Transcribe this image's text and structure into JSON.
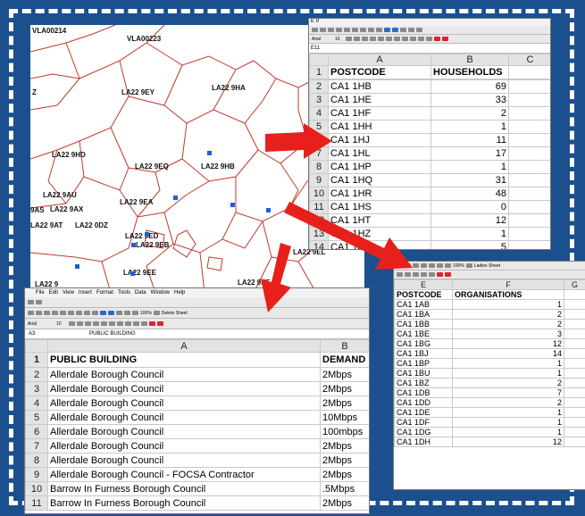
{
  "map": {
    "labels": [
      "VLA00214",
      "VLA00223",
      "LA22 9EY",
      "LA22 9HA",
      "LA22 9HD",
      "LA22 9EQ",
      "LA22 9HB",
      "LA22 9AU",
      "9AS",
      "LA22 9AX",
      "LA22 9EA",
      "LA22 9AT",
      "LA22 0DZ",
      "LA22 9ED",
      "LA22 9EB",
      "LA22 9EE",
      "LA22 9EL",
      "LA22 9EF",
      "LA22 9",
      "Z"
    ]
  },
  "sheet1": {
    "menu": "E 9",
    "font_name": "Arial",
    "font_size": "10",
    "cell_ref": "E11",
    "col_headers": [
      "A",
      "B",
      "C"
    ],
    "header": [
      "POSTCODE",
      "HOUSEHOLDS"
    ],
    "rows": [
      {
        "n": "2",
        "a": "CA1 1HB",
        "b": "69"
      },
      {
        "n": "3",
        "a": "CA1 1HE",
        "b": "33"
      },
      {
        "n": "4",
        "a": "CA1 1HF",
        "b": "2"
      },
      {
        "n": "5",
        "a": "CA1 1HH",
        "b": "1"
      },
      {
        "n": "6",
        "a": "CA1 1HJ",
        "b": "11"
      },
      {
        "n": "7",
        "a": "CA1 1HL",
        "b": "17"
      },
      {
        "n": "8",
        "a": "CA1 1HP",
        "b": "1"
      },
      {
        "n": "9",
        "a": "CA1 1HQ",
        "b": "31"
      },
      {
        "n": "10",
        "a": "CA1 1HR",
        "b": "48"
      },
      {
        "n": "11",
        "a": "CA1 1HS",
        "b": "0"
      },
      {
        "n": "12",
        "a": "CA1 1HT",
        "b": "12"
      },
      {
        "n": "13",
        "a": "CA1 1HZ",
        "b": "1"
      },
      {
        "n": "14",
        "a": "CA1 1JA",
        "b": "5"
      }
    ]
  },
  "sheet2": {
    "toolbar_text": "Ladies Sheet",
    "zoom": "100%",
    "col_headers": [
      "E",
      "F",
      "G"
    ],
    "header": [
      "POSTCODE",
      "ORGANISATIONS"
    ],
    "rows": [
      {
        "a": "CA1 1AB",
        "b": "1"
      },
      {
        "a": "CA1 1BA",
        "b": "2"
      },
      {
        "a": "CA1 1BB",
        "b": "2"
      },
      {
        "a": "CA1 1BE",
        "b": "3"
      },
      {
        "a": "CA1 1BG",
        "b": "12"
      },
      {
        "a": "CA1 1BJ",
        "b": "14"
      },
      {
        "a": "CA1 1BP",
        "b": "1"
      },
      {
        "a": "CA1 1BU",
        "b": "1"
      },
      {
        "a": "CA1 1BZ",
        "b": "2"
      },
      {
        "a": "CA1 1DB",
        "b": "7"
      },
      {
        "a": "CA1 1DD",
        "b": "2"
      },
      {
        "a": "CA1 1DE",
        "b": "1"
      },
      {
        "a": "CA1 1DF",
        "b": "1"
      },
      {
        "a": "CA1 1DG",
        "b": "1"
      },
      {
        "a": "CA1 1DH",
        "b": "12"
      }
    ]
  },
  "sheet3": {
    "menu": [
      "File",
      "Edit",
      "View",
      "Insert",
      "Format",
      "Tools",
      "Data",
      "Window",
      "Help"
    ],
    "zoom": "100%",
    "delete_sheet": "Delete Sheet",
    "font_name": "Arial",
    "font_size": "10",
    "cell_ref": "A3",
    "formula": "PUBLIC BUILDING",
    "col_headers": [
      "A",
      "B"
    ],
    "header": [
      "PUBLIC BUILDING",
      "DEMAND"
    ],
    "rows": [
      {
        "n": "2",
        "a": "Allerdale Borough Council",
        "b": "2Mbps"
      },
      {
        "n": "3",
        "a": "Allerdale Borough Council",
        "b": "2Mbps"
      },
      {
        "n": "4",
        "a": "Allerdale Borough Council",
        "b": "2Mbps"
      },
      {
        "n": "5",
        "a": "Allerdale Borough Council",
        "b": "10Mbps"
      },
      {
        "n": "6",
        "a": "Allerdale Borough Council",
        "b": "100mbps"
      },
      {
        "n": "7",
        "a": "Allerdale Borough Council",
        "b": "2Mbps"
      },
      {
        "n": "8",
        "a": "Allerdale Borough Council",
        "b": "2Mbps"
      },
      {
        "n": "9",
        "a": "Allerdale Borough Council - FOCSA Contractor",
        "b": "2Mbps"
      },
      {
        "n": "10",
        "a": "Barrow In Furness Borough Council",
        "b": ".5Mbps"
      },
      {
        "n": "11",
        "a": "Barrow In Furness Borough Council",
        "b": "2Mbps"
      }
    ]
  },
  "colors": {
    "background": "#1c4f8e",
    "arrow": "#e8201c",
    "map_line": "#c0392b",
    "point": "#1f5fd6"
  }
}
